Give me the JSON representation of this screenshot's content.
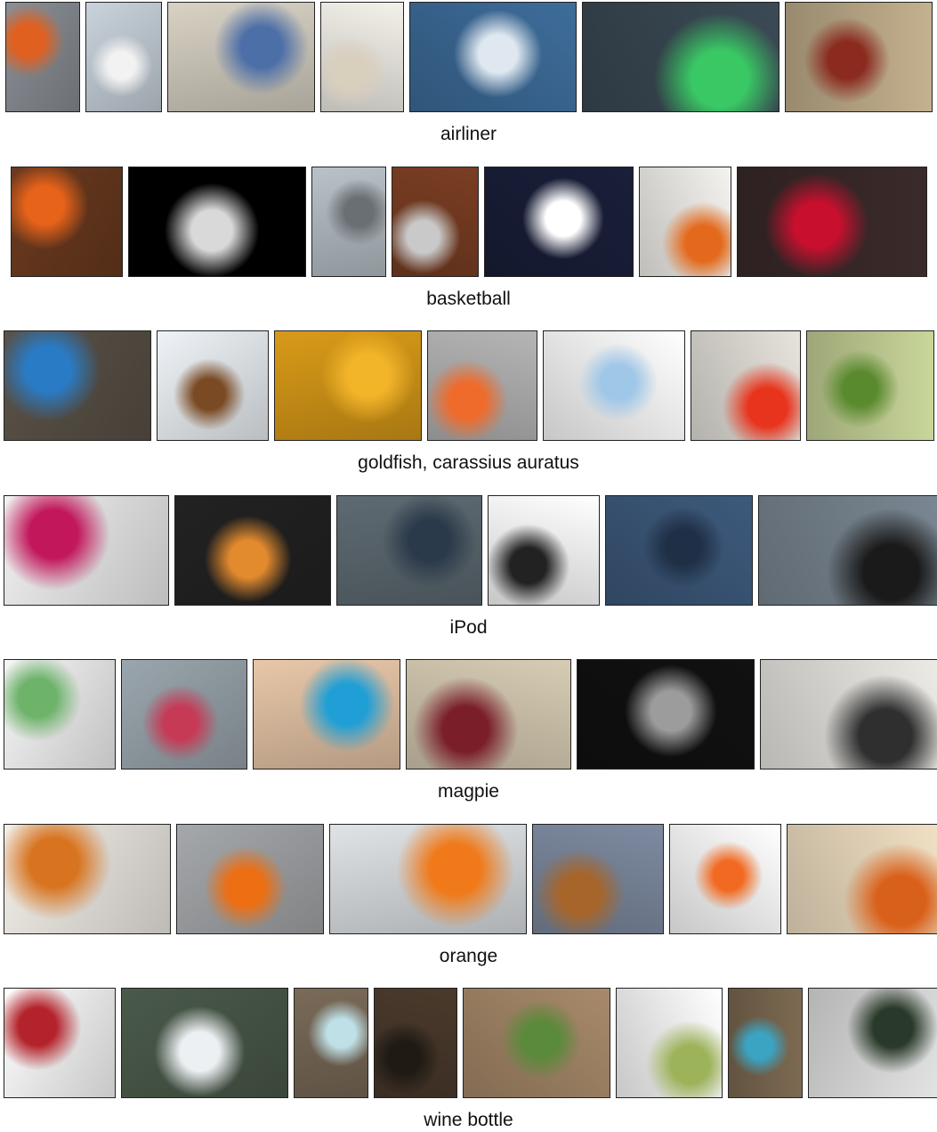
{
  "rows": [
    {
      "label": "airliner",
      "tiles": [
        {
          "w": 84,
          "bg": "#8a8f96",
          "accent": "#e06020"
        },
        {
          "w": 86,
          "bg": "#c9d3dc",
          "accent": "#f2f2f2"
        },
        {
          "w": 166,
          "bg": "#d8d2c4",
          "accent": "#4c6fa8"
        },
        {
          "w": 94,
          "bg": "#f4f1ea",
          "accent": "#d9cfbd"
        },
        {
          "w": 188,
          "bg": "#3e6d9b",
          "accent": "#dfe8f0"
        },
        {
          "w": 222,
          "bg": "#3b4a55",
          "accent": "#39c864"
        },
        {
          "w": 166,
          "bg": "#c4b18e",
          "accent": "#8b2a1f"
        }
      ]
    },
    {
      "label": "basketball",
      "tiles": [
        {
          "w": 126,
          "bg": "#6b3a1f",
          "accent": "#e8631a"
        },
        {
          "w": 200,
          "bg": "#000000",
          "accent": "#d9d9d9"
        },
        {
          "w": 84,
          "bg": "#b9c2c8",
          "accent": "#6a6f74"
        },
        {
          "w": 98,
          "bg": "#7a3e22",
          "accent": "#c9c9c9"
        },
        {
          "w": 168,
          "bg": "#1a1f3a",
          "accent": "#ffffff"
        },
        {
          "w": 104,
          "bg": "#f5f3ef",
          "accent": "#e36a1c"
        },
        {
          "w": 214,
          "bg": "#3b2a2a",
          "accent": "#c8102e"
        }
      ]
    },
    {
      "label": "goldfish, carassius auratus",
      "tiles": [
        {
          "w": 166,
          "bg": "#5a5248",
          "accent": "#2a7bc5"
        },
        {
          "w": 126,
          "bg": "#eef3f7",
          "accent": "#7a4a24"
        },
        {
          "w": 166,
          "bg": "#d99a18",
          "accent": "#f2b52a"
        },
        {
          "w": 124,
          "bg": "#b5b5b5",
          "accent": "#ef6b2c"
        },
        {
          "w": 160,
          "bg": "#ffffff",
          "accent": "#9fc7e8"
        },
        {
          "w": 124,
          "bg": "#e7e4dd",
          "accent": "#e8341c"
        },
        {
          "w": 144,
          "bg": "#c9d69a",
          "accent": "#5a8a2e"
        }
      ]
    },
    {
      "label": "iPod",
      "tiles": [
        {
          "w": 186,
          "bg": "#f2f2f2",
          "accent": "#c2185b"
        },
        {
          "w": 176,
          "bg": "#222222",
          "accent": "#e28a2e"
        },
        {
          "w": 164,
          "bg": "#5e6a72",
          "accent": "#2b3a4a"
        },
        {
          "w": 126,
          "bg": "#ffffff",
          "accent": "#222222"
        },
        {
          "w": 166,
          "bg": "#3d5a7c",
          "accent": "#1f2f46"
        },
        {
          "w": 214,
          "bg": "#7b8893",
          "accent": "#1a1a1a"
        }
      ]
    },
    {
      "label": "magpie",
      "tiles": [
        {
          "w": 126,
          "bg": "#f7f7f7",
          "accent": "#6db36a"
        },
        {
          "w": 142,
          "bg": "#9aa6ad",
          "accent": "#c63a56"
        },
        {
          "w": 166,
          "bg": "#e8c7a8",
          "accent": "#1f9fd6"
        },
        {
          "w": 186,
          "bg": "#d7ccb3",
          "accent": "#7a1f2a"
        },
        {
          "w": 200,
          "bg": "#111111",
          "accent": "#9c9c9c"
        },
        {
          "w": 202,
          "bg": "#ecebe6",
          "accent": "#2f2f2f"
        }
      ]
    },
    {
      "label": "orange",
      "tiles": [
        {
          "w": 188,
          "bg": "#f3efe8",
          "accent": "#d8741f"
        },
        {
          "w": 166,
          "bg": "#a5a8ab",
          "accent": "#ee6e12"
        },
        {
          "w": 222,
          "bg": "#dfe3e6",
          "accent": "#f07a1a"
        },
        {
          "w": 148,
          "bg": "#7d8aa0",
          "accent": "#a8652a"
        },
        {
          "w": 126,
          "bg": "#ffffff",
          "accent": "#f26a21"
        },
        {
          "w": 184,
          "bg": "#f4e3c6",
          "accent": "#d9601a"
        }
      ]
    },
    {
      "label": "wine bottle",
      "tiles": [
        {
          "w": 126,
          "bg": "#ffffff",
          "accent": "#b4232b"
        },
        {
          "w": 188,
          "bg": "#4a5a4a",
          "accent": "#ecf0f3"
        },
        {
          "w": 84,
          "bg": "#7a6a58",
          "accent": "#bfe0e6"
        },
        {
          "w": 94,
          "bg": "#4a3a2c",
          "accent": "#1f1a14"
        },
        {
          "w": 166,
          "bg": "#a88a6a",
          "accent": "#5a8a3a"
        },
        {
          "w": 120,
          "bg": "#ffffff",
          "accent": "#9db35a"
        },
        {
          "w": 84,
          "bg": "#7d6a52",
          "accent": "#3ba4c3"
        },
        {
          "w": 162,
          "bg": "#e7e7e7",
          "accent": "#2a3a2a"
        }
      ]
    }
  ]
}
